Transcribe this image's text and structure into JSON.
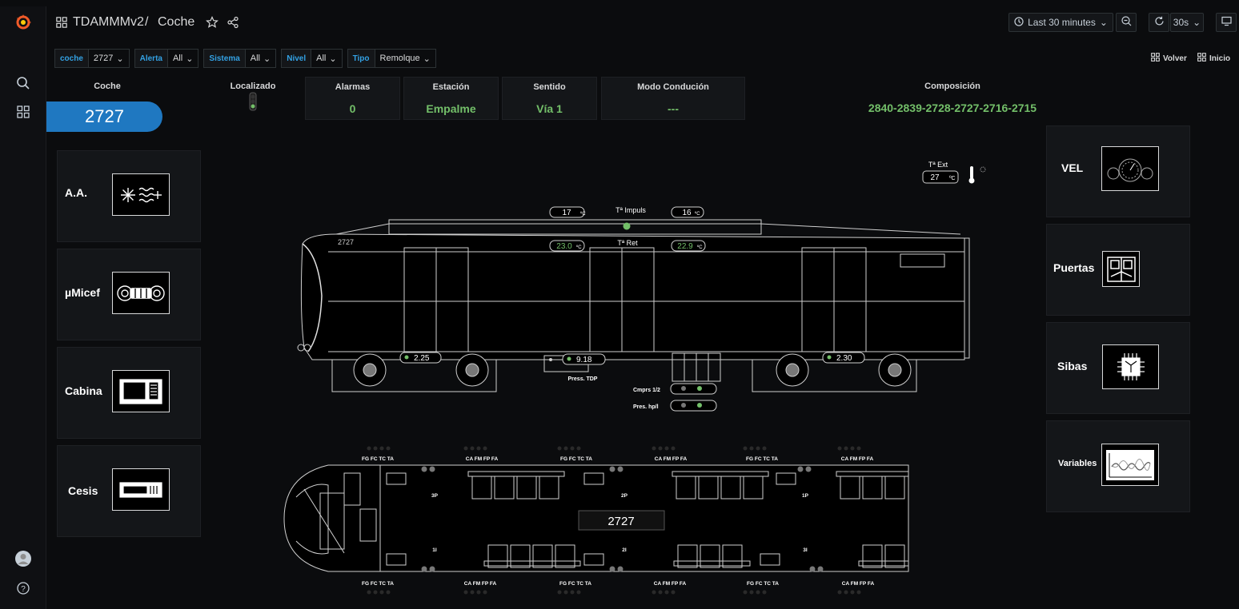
{
  "header": {
    "dashboard": "TDAMMMv2",
    "separator": "/",
    "page": "Coche",
    "time_range": "Last 30 minutes",
    "refresh": "30s"
  },
  "variables": [
    {
      "label": "coche",
      "value": "2727"
    },
    {
      "label": "Alerta",
      "value": "All"
    },
    {
      "label": "Sistema",
      "value": "All"
    },
    {
      "label": "Nivel",
      "value": "All"
    },
    {
      "label": "Tipo",
      "value": "Remolque"
    }
  ],
  "links": {
    "volver": "Volver",
    "inicio": "Inicio"
  },
  "coche": {
    "title": "Coche",
    "value": "2727"
  },
  "localizado": {
    "title": "Localizado"
  },
  "stats": [
    {
      "title": "Alarmas",
      "value": "0"
    },
    {
      "title": "Estación",
      "value": "Empalme"
    },
    {
      "title": "Sentido",
      "value": "Vía 1"
    },
    {
      "title": "Modo Condución",
      "value": "---"
    }
  ],
  "composicion": {
    "title": "Composición",
    "value": "2840-2839-2728-2727-2716-2715"
  },
  "left_panels": [
    "A.A.",
    "µMicef",
    "Cabina",
    "Cesis"
  ],
  "right_panels": [
    "VEL",
    "Puertas",
    "Sibas",
    "Variables"
  ],
  "train": {
    "car_number": "2727",
    "temp_ext_label": "Tª Ext",
    "temp_ext": "27",
    "temp_unit": "ºC",
    "impuls_label": "Tª Impuls",
    "impuls_left": "17",
    "impuls_right": "16",
    "ret_label": "Tª Ret",
    "ret_left": "23.0",
    "ret_right": "22.9",
    "pressure_left": "2.25",
    "pressure_tdp": "9.18",
    "pressure_tdp_label": "Press. TDP",
    "pressure_right": "2.30",
    "cmprs_label": "Cmprs 1/2",
    "pres_label": "Pres. hp/l"
  },
  "plan": {
    "car_number": "2727",
    "top_groups": [
      "FG FC TC TA",
      "CA FM FP FA",
      "FG FC TC TA",
      "CA FM FP FA",
      "FG FC TC TA",
      "CA FM FP FA"
    ],
    "bottom_groups": [
      "FG FC TC TA",
      "CA FM FP FA",
      "FG FC TC TA",
      "CA FM FP FA",
      "FG FC TC TA",
      "CA FM FP FA"
    ],
    "doors_top": [
      "3P",
      "2P",
      "1P"
    ],
    "doors_bottom": [
      "1I",
      "2I",
      "3I"
    ]
  },
  "colors": {
    "accent_blue": "#1f78c1",
    "value_green": "#73bf69",
    "link_blue": "#33a2e5",
    "grafana_orange": "#f05a28"
  }
}
